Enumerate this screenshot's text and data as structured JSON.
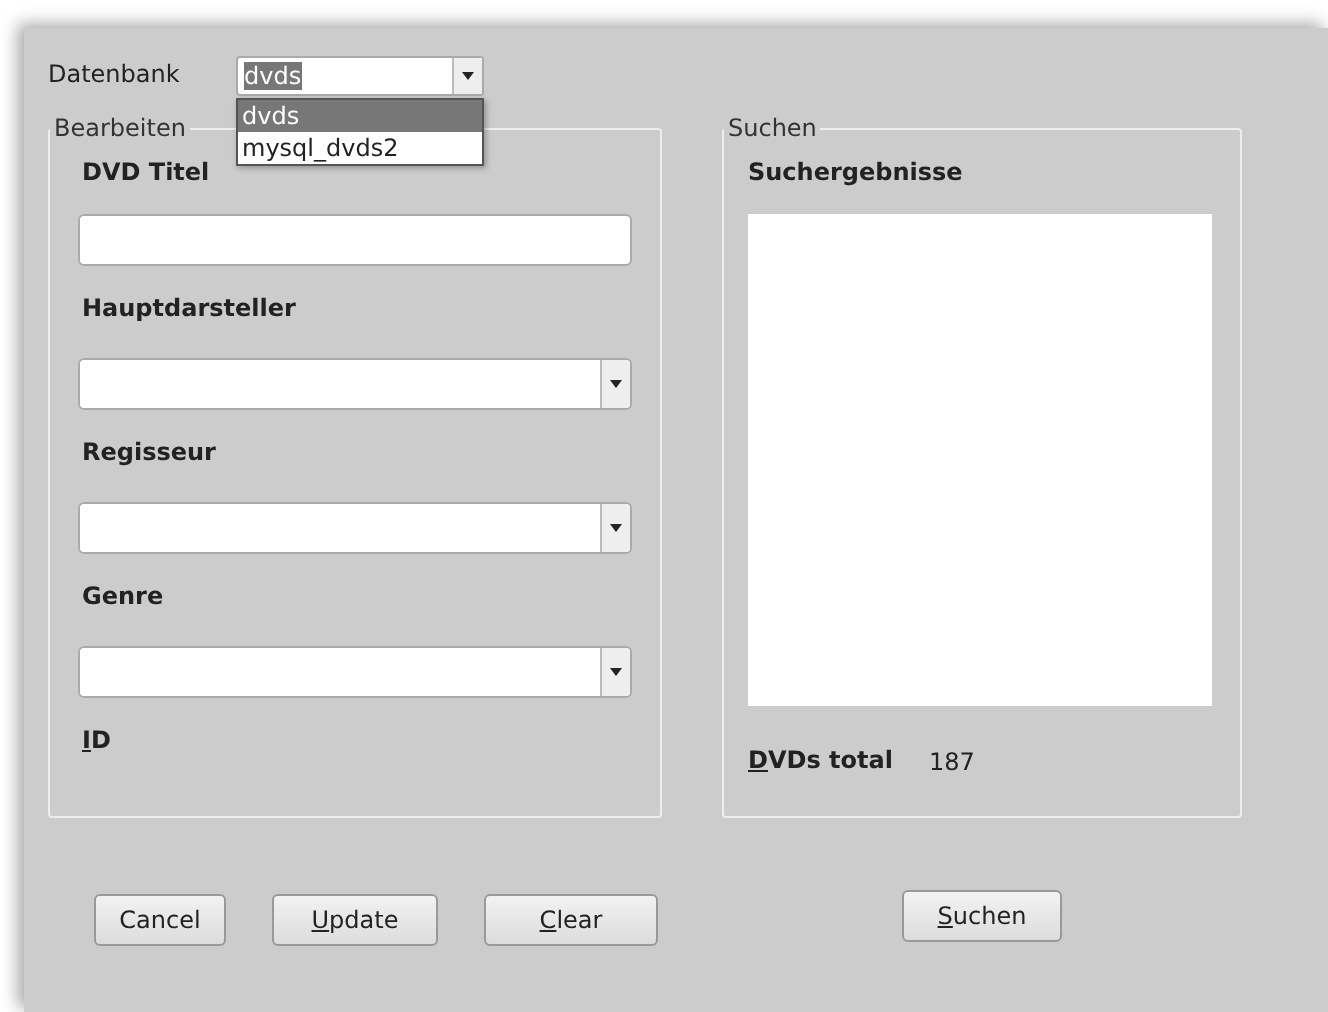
{
  "database": {
    "label": "Datenbank",
    "value": "dvds",
    "expanded": true,
    "options": [
      {
        "label": "dvds",
        "selected": true
      },
      {
        "label": "mysql_dvds2",
        "selected": false
      }
    ]
  },
  "edit_group": {
    "title": "Bearbeiten",
    "fields": [
      {
        "label": "DVD Titel",
        "kind": "text",
        "underline_first": false
      },
      {
        "label": "Hauptdarsteller",
        "kind": "combo",
        "underline_first": false
      },
      {
        "label": "Regisseur",
        "kind": "combo",
        "underline_first": false
      },
      {
        "label": "Genre",
        "kind": "combo",
        "underline_first": false
      },
      {
        "label": "ID",
        "kind": "label",
        "underline_first": true
      }
    ]
  },
  "search_group": {
    "title": "Suchen",
    "results_label": "Suchergebnisse",
    "total_label": "DVDs total",
    "total_underline_first": true,
    "total_value": "187"
  },
  "buttons": [
    {
      "label": "Cancel",
      "underline_first": false
    },
    {
      "label": "Update",
      "underline_first": true
    },
    {
      "label": "Clear",
      "underline_first": true
    }
  ],
  "search_button": {
    "label": "Suchen",
    "underline_first": true
  }
}
